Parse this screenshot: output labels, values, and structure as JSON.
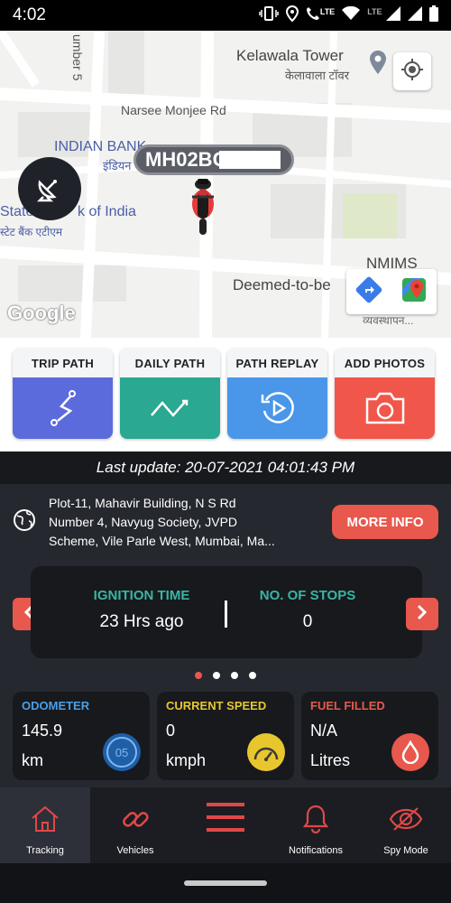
{
  "status_bar": {
    "time": "4:02",
    "lte1": "LTE",
    "lte2": "LTE"
  },
  "map": {
    "labels": {
      "kelawala_tower": "Kelawala Tower",
      "kelawala_tower_hi": "केलावाला टॉवर",
      "road_number5": "umber 5",
      "narsee_monjee": "Narsee Monjee Rd",
      "indian_bank": "INDIAN BANK",
      "indian_bank_hi": "इंडियन बै",
      "state_bank": "State",
      "state_bank2": "k of India",
      "state_bank_hi": "स्टेट बैंक एटीएम",
      "nmims": "NMIMS",
      "deemed": "Deemed-to-be",
      "nmims_hi": "व्यवस्थापन..."
    },
    "google_logo": "Google",
    "vehicle_number": "MH02BC"
  },
  "actions": [
    {
      "label": "TRIP PATH",
      "color": "#5b6bdc",
      "icon": "trip-path-icon"
    },
    {
      "label": "DAILY PATH",
      "color": "#2aa891",
      "icon": "daily-path-icon"
    },
    {
      "label": "PATH REPLAY",
      "color": "#4a96e8",
      "icon": "replay-icon"
    },
    {
      "label": "ADD PHOTOS",
      "color": "#f0564a",
      "icon": "camera-icon"
    }
  ],
  "last_update": "Last update: 20-07-2021 04:01:43 PM",
  "address": {
    "line1": "Plot-11, Mahavir Building, N S Rd",
    "line2": "Number 4, Navyug Society, JVPD",
    "line3": "Scheme, Vile Parle West, Mumbai, Ma..."
  },
  "more_info_label": "MORE INFO",
  "info_card": {
    "ignition_title": "IGNITION TIME",
    "ignition_value": "23 Hrs ago",
    "stops_title": "NO. OF STOPS",
    "stops_value": "0",
    "active_page": 1,
    "page_count": 4
  },
  "stats": {
    "odometer": {
      "title": "ODOMETER",
      "value": "145.9",
      "unit": "km",
      "icon_text": "05",
      "title_color": "#4a9fe8"
    },
    "speed": {
      "title": "CURRENT SPEED",
      "value": "0",
      "unit": "kmph",
      "title_color": "#e8c72e"
    },
    "fuel": {
      "title": "FUEL FILLED",
      "value": "N/A",
      "unit": "Litres",
      "title_color": "#e8584d"
    }
  },
  "bottom_nav": [
    {
      "label": "Tracking",
      "icon": "home-icon",
      "active": true
    },
    {
      "label": "Vehicles",
      "icon": "chain-link-icon",
      "active": false
    },
    {
      "label": "",
      "icon": "menu-icon",
      "active": false
    },
    {
      "label": "Notifications",
      "icon": "bell-icon",
      "active": false
    },
    {
      "label": "Spy Mode",
      "icon": "eye-icon",
      "active": false
    }
  ]
}
